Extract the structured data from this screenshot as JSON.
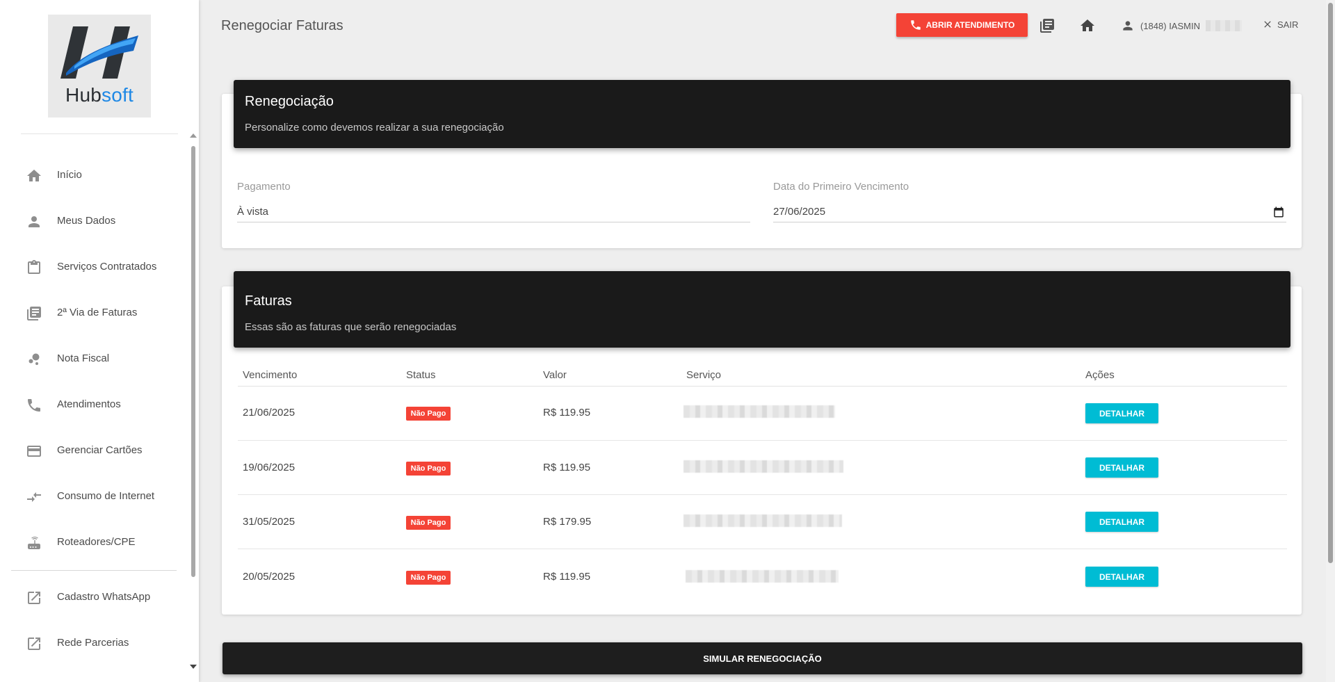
{
  "app": {
    "logo_text_a": "Hub",
    "logo_text_b": "soft",
    "brand_color": "#1e88e5"
  },
  "sidebar": {
    "items": [
      {
        "label": "Início",
        "icon": "home-icon"
      },
      {
        "label": "Meus Dados",
        "icon": "person-icon"
      },
      {
        "label": "Serviços Contratados",
        "icon": "clipboard-icon"
      },
      {
        "label": "2ª Via de Faturas",
        "icon": "library-books-icon"
      },
      {
        "label": "Nota Fiscal",
        "icon": "bubble-chart-icon"
      },
      {
        "label": "Atendimentos",
        "icon": "phone-icon"
      },
      {
        "label": "Gerenciar Cartões",
        "icon": "credit-card-icon"
      },
      {
        "label": "Consumo de Internet",
        "icon": "compare-arrows-icon"
      },
      {
        "label": "Roteadores/CPE",
        "icon": "router-icon"
      }
    ],
    "external_items": [
      {
        "label": "Cadastro WhatsApp",
        "icon": "open-in-new-icon"
      },
      {
        "label": "Rede Parcerias",
        "icon": "open-in-new-icon"
      }
    ]
  },
  "header": {
    "title": "Renegociar Faturas",
    "abrir_label": "ABRIR ATENDIMENTO",
    "user_label": "(1848) IASMIN",
    "sair_label": "SAIR",
    "accent_color": "#f44336"
  },
  "renegociacao": {
    "title": "Renegociação",
    "subtitle": "Personalize como devemos realizar a sua renegociação",
    "pagamento_label": "Pagamento",
    "pagamento_value": "À vista",
    "data_label": "Data do Primeiro Vencimento",
    "data_value": "27/06/2025"
  },
  "faturas": {
    "title": "Faturas",
    "subtitle": "Essas são as faturas que serão renegociadas",
    "columns": [
      "Vencimento",
      "Status",
      "Valor",
      "Serviço",
      "Ações"
    ],
    "rows": [
      {
        "vencimento": "21/06/2025",
        "status": "Não Pago",
        "valor": "R$ 119.95",
        "acao": "DETALHAR"
      },
      {
        "vencimento": "19/06/2025",
        "status": "Não Pago",
        "valor": "R$ 119.95",
        "acao": "DETALHAR"
      },
      {
        "vencimento": "31/05/2025",
        "status": "Não Pago",
        "valor": "R$ 179.95",
        "acao": "DETALHAR"
      },
      {
        "vencimento": "20/05/2025",
        "status": "Não Pago",
        "valor": "R$ 119.95",
        "acao": "DETALHAR"
      }
    ],
    "detail_color": "#00bcd4"
  },
  "footer": {
    "simular_label": "SIMULAR RENEGOCIAÇÃO"
  }
}
